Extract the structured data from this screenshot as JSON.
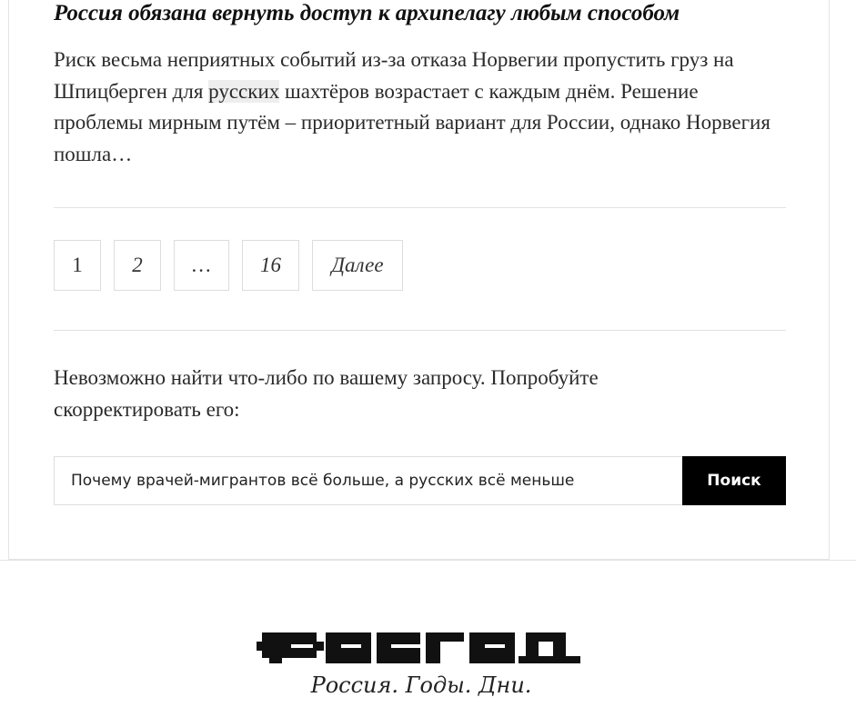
{
  "article": {
    "title": "Россия обязана вернуть доступ к архипелагу любым способом",
    "excerpt_before": "Риск весьма неприятных событий из-за отказа Норвегии пропустить груз на Шпицберген для ",
    "excerpt_highlight": "русских",
    "excerpt_after": " шахтёров возрастает с каждым днём. Решение проблемы мирным путём – приоритетный вариант для России, однако Норвегия пошла…"
  },
  "pagination": {
    "pages": [
      "1",
      "2",
      "…",
      "16"
    ],
    "next_label": "Далее"
  },
  "search": {
    "message": "Невозможно найти что-либо по вашему запросу. Попробуйте скорректировать его:",
    "query": "Почему врачей-мигрантов всё больше, а русских всё меньше",
    "button_label": "Поиск"
  },
  "footer": {
    "logo_text": "РОСГОД",
    "logo_tagline": "Россия. Годы. Дни."
  }
}
